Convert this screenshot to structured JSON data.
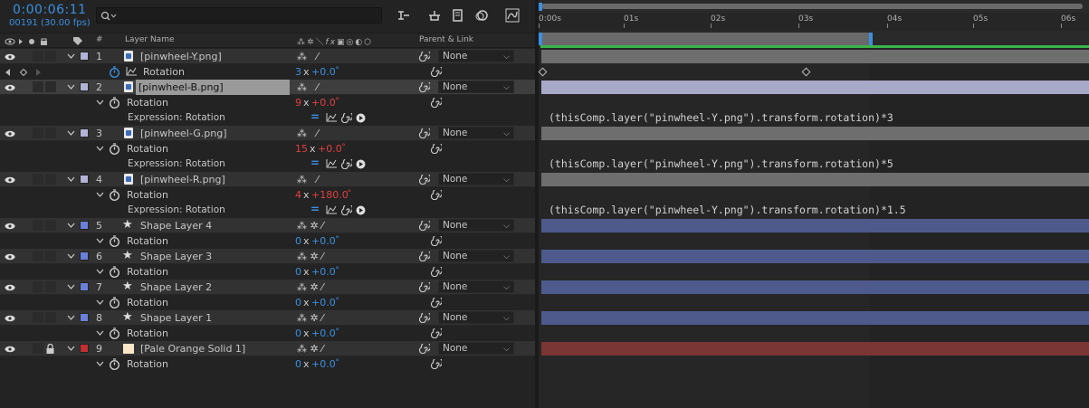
{
  "comp": {
    "timecode": "0:00:06:11",
    "frame_info": "00191 (30.00 fps)"
  },
  "search": {
    "placeholder": ""
  },
  "columns": {
    "layer_name": "Layer Name",
    "num": "#",
    "parent_link": "Parent & Link"
  },
  "ruler": {
    "ticks": [
      "0:00s",
      "01s",
      "02s",
      "03s",
      "04s",
      "05s",
      "06s"
    ]
  },
  "layers": [
    {
      "index": "1",
      "name": "[pinwheel-Y.png]",
      "parent": "None",
      "label_color": "#b3b3d8",
      "kind": "file",
      "bar_color": "#6e6e6e",
      "prop": {
        "label": "Rotation",
        "rev": "3",
        "x": "x",
        "deg": "+0.0",
        "unit": "°"
      }
    },
    {
      "index": "2",
      "name": "[pinwheel-B.png]",
      "parent": "None",
      "label_color": "#b3b3d8",
      "kind": "file",
      "bar_color": "#a8a8c8",
      "prop": {
        "label": "Rotation",
        "rev": "9",
        "x": "x",
        "deg": "+0.0",
        "unit": "°"
      },
      "expr_label": "Expression: Rotation",
      "expr": "(thisComp.layer(\"pinwheel-Y.png\").transform.rotation)*3"
    },
    {
      "index": "3",
      "name": "[pinwheel-G.png]",
      "parent": "None",
      "label_color": "#b3b3d8",
      "kind": "file",
      "bar_color": "#6e6e6e",
      "prop": {
        "label": "Rotation",
        "rev": "15",
        "x": "x",
        "deg": "+0.0",
        "unit": "°"
      },
      "expr_label": "Expression: Rotation",
      "expr": "(thisComp.layer(\"pinwheel-Y.png\").transform.rotation)*5"
    },
    {
      "index": "4",
      "name": "[pinwheel-R.png]",
      "parent": "None",
      "label_color": "#b3b3d8",
      "kind": "file",
      "bar_color": "#6e6e6e",
      "prop": {
        "label": "Rotation",
        "rev": "4",
        "x": "x",
        "deg": "+180.0",
        "unit": "°"
      },
      "expr_label": "Expression: Rotation",
      "expr": "(thisComp.layer(\"pinwheel-Y.png\").transform.rotation)*1.5"
    },
    {
      "index": "5",
      "name": "Shape Layer 4",
      "parent": "None",
      "label_color": "#6a7fd8",
      "kind": "shape",
      "bar_color": "#4e5a8c",
      "prop": {
        "label": "Rotation",
        "rev": "0",
        "x": "x",
        "deg": "+0.0",
        "unit": "°"
      }
    },
    {
      "index": "6",
      "name": "Shape Layer 3",
      "parent": "None",
      "label_color": "#6a7fd8",
      "kind": "shape",
      "bar_color": "#4e5a8c",
      "prop": {
        "label": "Rotation",
        "rev": "0",
        "x": "x",
        "deg": "+0.0",
        "unit": "°"
      }
    },
    {
      "index": "7",
      "name": "Shape Layer 2",
      "parent": "None",
      "label_color": "#6a7fd8",
      "kind": "shape",
      "bar_color": "#4e5a8c",
      "prop": {
        "label": "Rotation",
        "rev": "0",
        "x": "x",
        "deg": "+0.0",
        "unit": "°"
      }
    },
    {
      "index": "8",
      "name": "Shape Layer 1",
      "parent": "None",
      "label_color": "#6a7fd8",
      "kind": "shape",
      "bar_color": "#4e5a8c",
      "prop": {
        "label": "Rotation",
        "rev": "0",
        "x": "x",
        "deg": "+0.0",
        "unit": "°"
      }
    },
    {
      "index": "9",
      "name": "[Pale Orange Solid 1]",
      "parent": "None",
      "label_color": "#c03030",
      "kind": "solid",
      "bar_color": "#7a3535",
      "prop": {
        "label": "Rotation",
        "rev": "0",
        "x": "x",
        "deg": "+0.0",
        "unit": "°"
      }
    }
  ],
  "colors": {
    "accent": "#3b8fe0",
    "work_area": "#3bb54a",
    "value_red": "#e04040"
  }
}
